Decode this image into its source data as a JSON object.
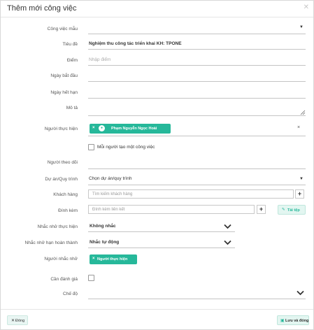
{
  "modal": {
    "title": "Thêm mới công việc"
  },
  "fields": {
    "template": {
      "label": "Công việc mẫu",
      "value": ""
    },
    "title": {
      "label": "Tiêu đề",
      "value": "Nghiệm thu công tác triển khai KH: TPONE"
    },
    "score": {
      "label": "Điểm",
      "placeholder": "Nhập điểm"
    },
    "start_date": {
      "label": "Ngày bắt đầu",
      "value": ""
    },
    "end_date": {
      "label": "Ngày hết hạn",
      "value": ""
    },
    "description": {
      "label": "Mô tả",
      "value": ""
    },
    "assignee": {
      "label": "Người thực hiện",
      "chip_label": "Phạm Nguyễn Ngọc Hoài",
      "remove": "×"
    },
    "per_person": {
      "label": "Mỗi người tạo một công việc",
      "checked": false
    },
    "follower": {
      "label": "Người theo dõi",
      "value": ""
    },
    "project": {
      "label": "Dự án/Quy trình",
      "value": "Chọn dự án/quy trình"
    },
    "customer": {
      "label": "Khách hàng",
      "placeholder": "Tìm kiếm khách hàng",
      "add": "+"
    },
    "attachment": {
      "label": "Đính kèm",
      "placeholder": "Đính kèm liên kết",
      "add": "+",
      "file_button": "Tải tệp"
    },
    "remind_exec": {
      "label": "Nhắc nhở thực hiện",
      "value": "Không nhắc"
    },
    "remind_deadline": {
      "label": "Nhắc nhở hạn hoàn thành",
      "value": "Nhắc tự động"
    },
    "reminded_person": {
      "label": "Người nhắc nhở",
      "chip_label": "Người thực hiện",
      "chip_remove": "×"
    },
    "need_review": {
      "label": "Cần đánh giá",
      "checked": false
    },
    "mode": {
      "label": "Chế độ",
      "value": ""
    }
  },
  "footer": {
    "close_label": "Đóng",
    "save_label": "Lưu và đóng"
  },
  "colors": {
    "accent": "#26b89a",
    "save_bg": "#e3f6f1",
    "close_bg": "#e9f6f3"
  }
}
